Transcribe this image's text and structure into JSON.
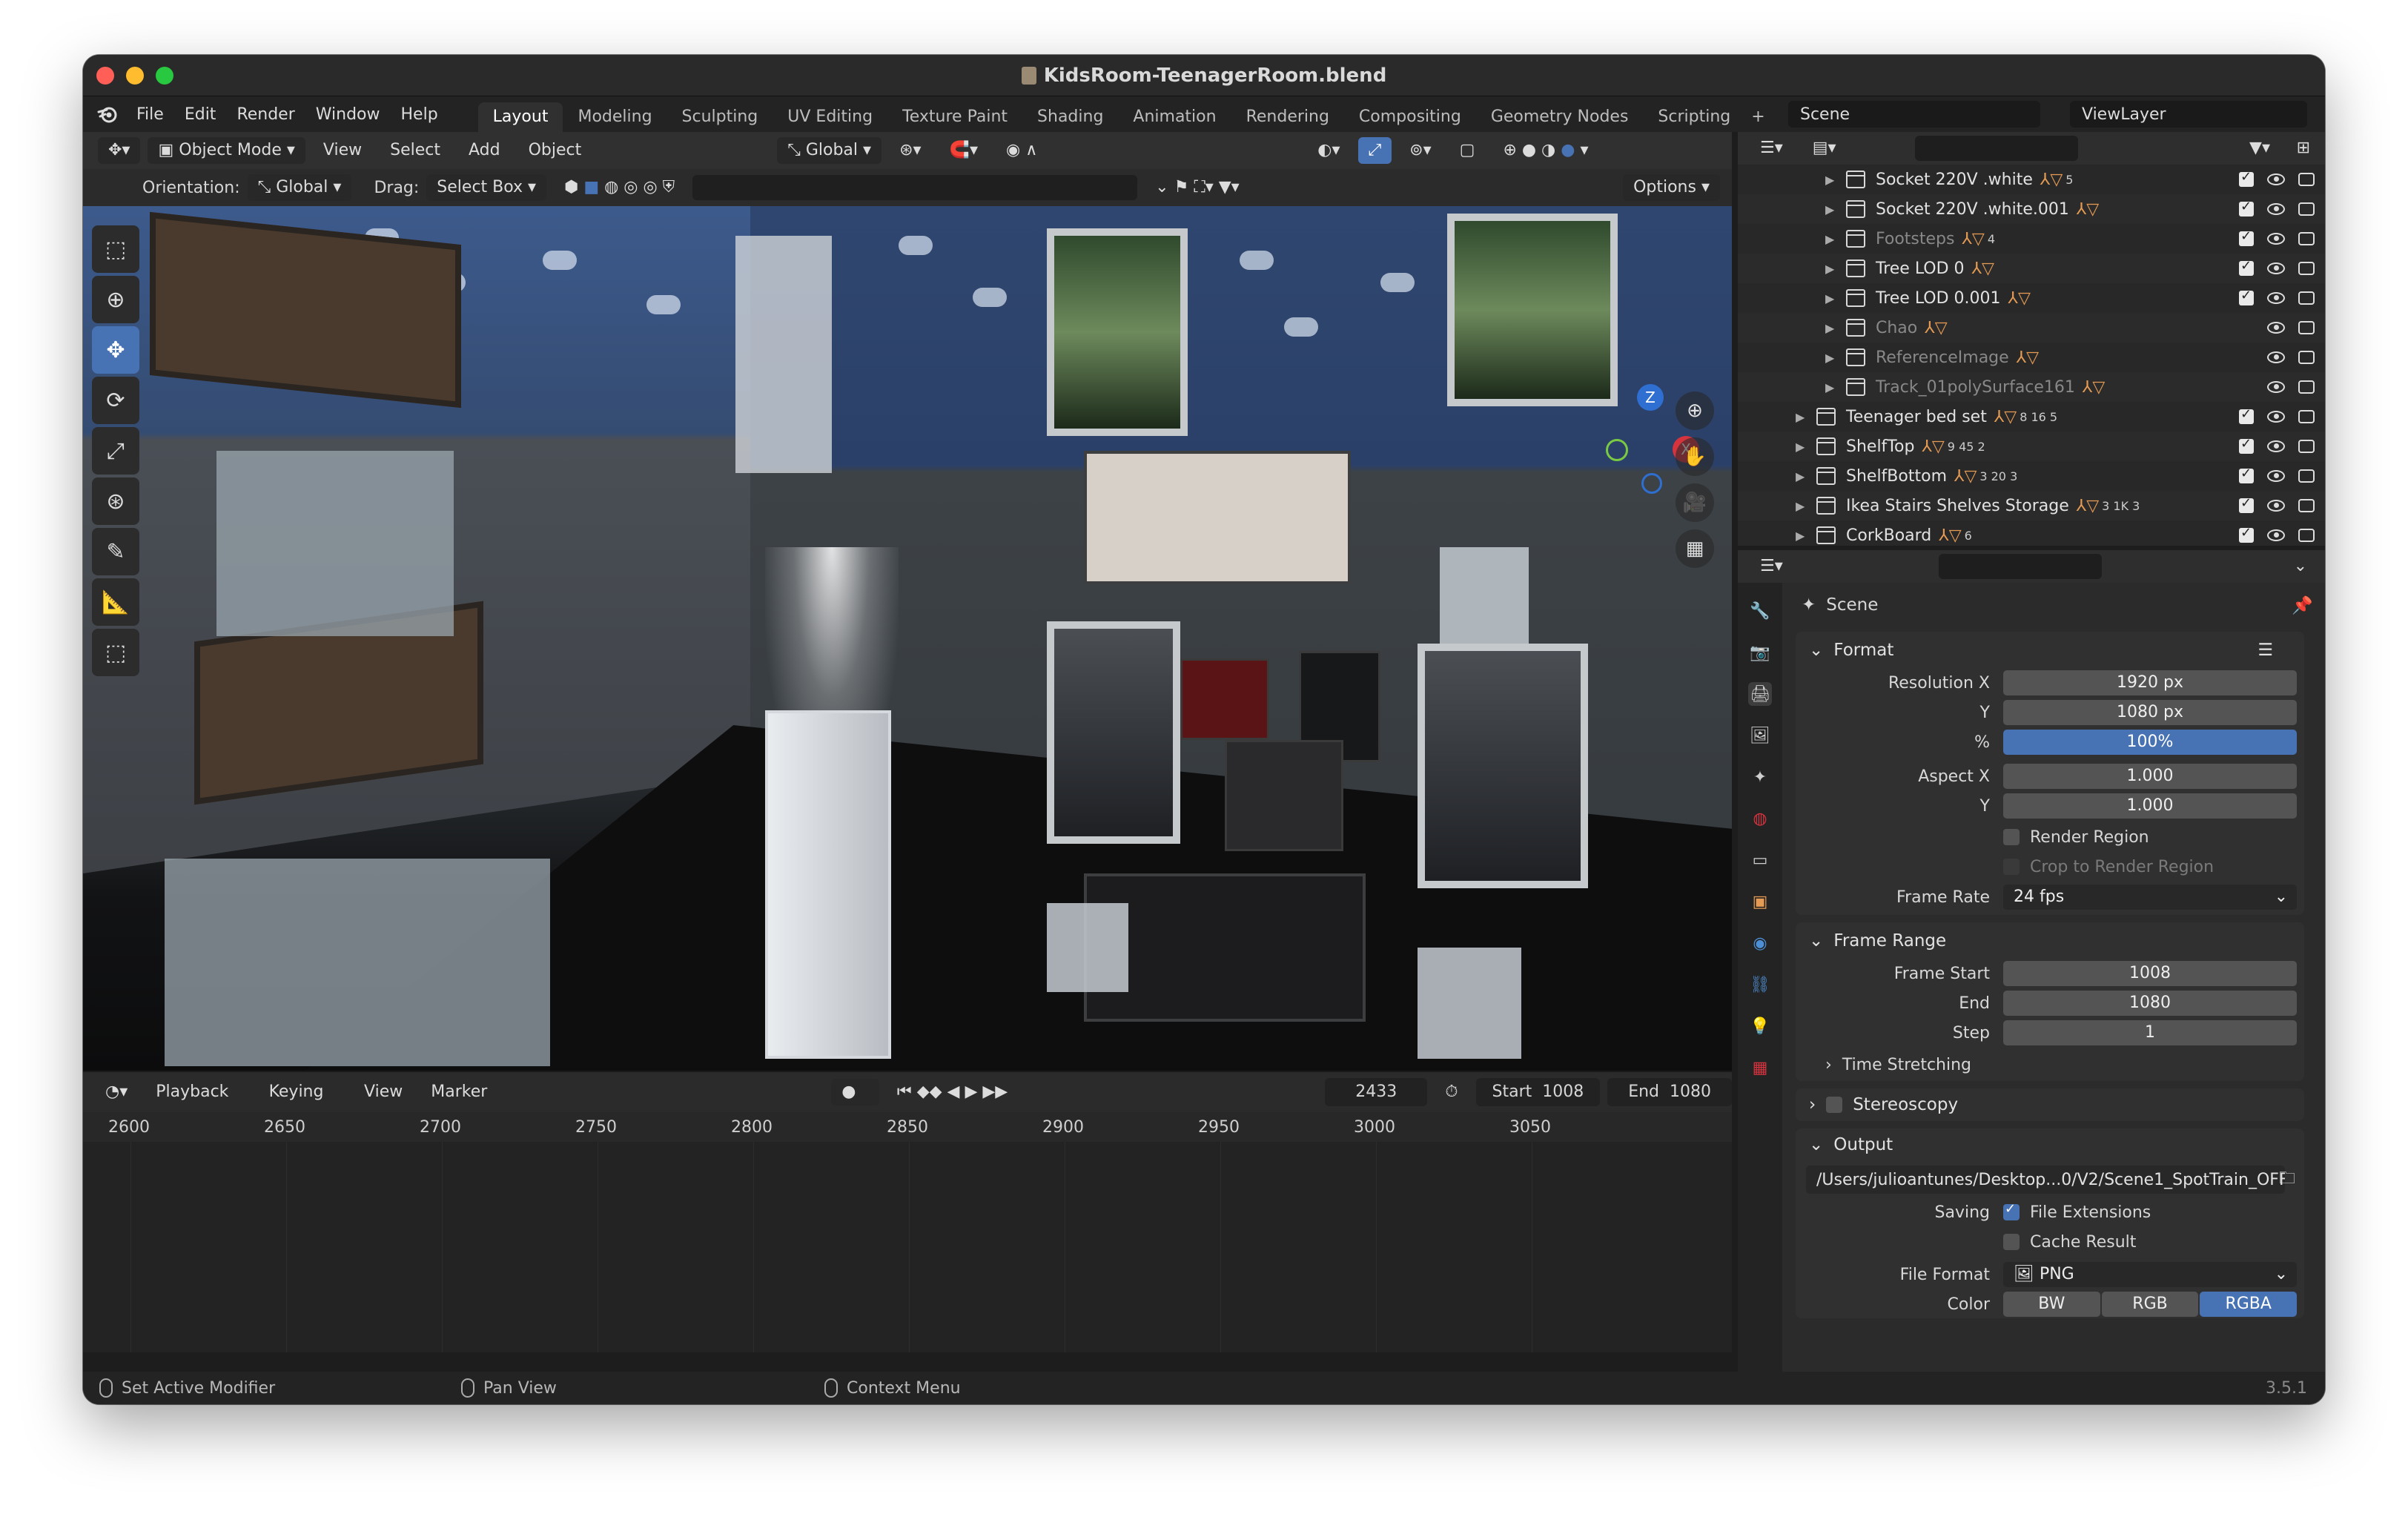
{
  "window": {
    "title": "KidsRoom-TeenagerRoom.blend",
    "traffic": {
      "close": "#ff5f57",
      "minimize": "#febc2e",
      "maximize": "#28c840"
    }
  },
  "menubar": {
    "items": [
      "File",
      "Edit",
      "Render",
      "Window",
      "Help"
    ],
    "workspaces": [
      "Layout",
      "Modeling",
      "Sculpting",
      "UV Editing",
      "Texture Paint",
      "Shading",
      "Animation",
      "Rendering",
      "Compositing",
      "Geometry Nodes",
      "Scripting"
    ],
    "add_workspace": "+",
    "scene": "Scene",
    "view_layer": "ViewLayer"
  },
  "viewport_header": {
    "mode": "Object Mode",
    "menus": [
      "View",
      "Select",
      "Add",
      "Object"
    ],
    "transform": "Global"
  },
  "tool_settings": {
    "orientation_label": "Orientation:",
    "orientation_value": "Global",
    "drag_label": "Drag:",
    "drag_value": "Select Box",
    "options": "Options"
  },
  "gizmo": {
    "z": "Z",
    "x": "X",
    "y": "Y"
  },
  "timeline": {
    "menus": [
      "Playback",
      "Keying",
      "View",
      "Marker"
    ],
    "current_frame": "2433",
    "start_label": "Start",
    "start_value": "1008",
    "end_label": "End",
    "end_value": "1080",
    "ticks": [
      "2600",
      "2650",
      "2700",
      "2750",
      "2800",
      "2850",
      "2900",
      "2950",
      "3000",
      "3050"
    ]
  },
  "statusbar": {
    "left": "Set Active Modifier",
    "middle": "Pan View",
    "right": "Context Menu",
    "version": "3.5.1"
  },
  "outliner": {
    "rows": [
      {
        "name": "Socket 220V .white",
        "dim": false,
        "meta": "5",
        "visible": true
      },
      {
        "name": "Socket 220V .white.001",
        "dim": false,
        "meta": "",
        "visible": true
      },
      {
        "name": "Footsteps",
        "dim": true,
        "meta": "4",
        "visible": true
      },
      {
        "name": "Tree LOD 0",
        "dim": false,
        "meta": "",
        "visible": true
      },
      {
        "name": "Tree LOD 0.001",
        "dim": false,
        "meta": "",
        "visible": true
      },
      {
        "name": "Chao",
        "dim": true,
        "meta": "",
        "visible": false
      },
      {
        "name": "ReferenceImage",
        "dim": true,
        "meta": "",
        "visible": false
      },
      {
        "name": "Track_01polySurface161",
        "dim": true,
        "meta": "",
        "visible": false
      },
      {
        "name": "Teenager bed set",
        "dim": false,
        "meta": "8 16 5",
        "visible": true
      },
      {
        "name": "ShelfTop",
        "dim": false,
        "meta": "9 45 2",
        "visible": true
      },
      {
        "name": "ShelfBottom",
        "dim": false,
        "meta": "3 20 3",
        "visible": true
      },
      {
        "name": "Ikea Stairs Shelves Storage",
        "dim": false,
        "meta": "3 1K 3",
        "visible": true
      },
      {
        "name": "CorkBoard",
        "dim": false,
        "meta": "6",
        "visible": true
      }
    ]
  },
  "properties": {
    "scene_name": "Scene",
    "format": {
      "title": "Format",
      "resolution_x_label": "Resolution X",
      "resolution_x": "1920 px",
      "resolution_y_label": "Y",
      "resolution_y": "1080 px",
      "percent_label": "%",
      "percent": "100%",
      "aspect_x_label": "Aspect X",
      "aspect_x": "1.000",
      "aspect_y_label": "Y",
      "aspect_y": "1.000",
      "render_region": "Render Region",
      "crop": "Crop to Render Region",
      "frame_rate_label": "Frame Rate",
      "frame_rate": "24 fps"
    },
    "frame_range": {
      "title": "Frame Range",
      "start_label": "Frame Start",
      "start": "1008",
      "end_label": "End",
      "end": "1080",
      "step_label": "Step",
      "step": "1",
      "time_stretching": "Time Stretching"
    },
    "stereoscopy": "Stereoscopy",
    "output": {
      "title": "Output",
      "path": "/Users/julioantunes/Desktop...0/V2/Scene1_SpotTrain_OFF_",
      "saving_label": "Saving",
      "file_extensions": "File Extensions",
      "cache_result": "Cache Result",
      "file_format_label": "File Format",
      "file_format": "PNG",
      "color_label": "Color",
      "color_options": [
        "BW",
        "RGB",
        "RGBA"
      ]
    }
  },
  "colors": {
    "accent": "#4772b3",
    "orange": "#e59b53",
    "bg": "#1d1d1d"
  }
}
